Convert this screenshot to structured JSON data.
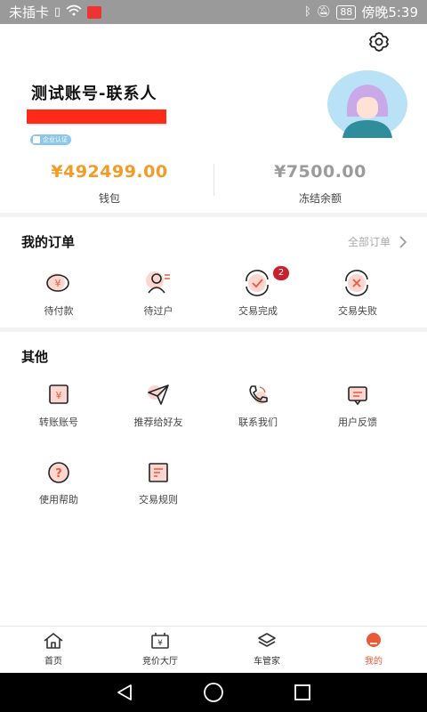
{
  "status_bar": {
    "carrier": "未插卡",
    "battery": "88",
    "time": "傍晚5:39"
  },
  "profile": {
    "name": "测试账号-联系人",
    "badge": "企业认证"
  },
  "balances": {
    "wallet_value": "¥492499.00",
    "wallet_label": "钱包",
    "frozen_value": "¥7500.00",
    "frozen_label": "冻结余额"
  },
  "orders": {
    "title": "我的订单",
    "all_link": "全部订单",
    "items": [
      {
        "label": "待付款",
        "icon": "yuan-wallet-icon"
      },
      {
        "label": "待过户",
        "icon": "user-transfer-icon"
      },
      {
        "label": "交易完成",
        "icon": "check-cycle-icon",
        "count": "2"
      },
      {
        "label": "交易失败",
        "icon": "close-cycle-icon"
      }
    ]
  },
  "other": {
    "title": "其他",
    "items": [
      {
        "label": "转账账号",
        "icon": "yuan-card-icon"
      },
      {
        "label": "推荐给好友",
        "icon": "send-icon"
      },
      {
        "label": "联系我们",
        "icon": "phone-icon"
      },
      {
        "label": "用户反馈",
        "icon": "feedback-icon"
      },
      {
        "label": "使用帮助",
        "icon": "help-icon"
      },
      {
        "label": "交易规则",
        "icon": "rules-doc-icon"
      }
    ]
  },
  "tabbar": {
    "items": [
      {
        "label": "首页",
        "icon": "home-icon"
      },
      {
        "label": "竞价大厅",
        "icon": "auction-icon"
      },
      {
        "label": "车管家",
        "icon": "layers-icon"
      },
      {
        "label": "我的",
        "icon": "profile-icon",
        "active": true
      }
    ]
  },
  "colors": {
    "accent": "#e85b3a",
    "wallet": "#f39b26",
    "frozen": "#9b9b9b",
    "redacted": "#ff2a1a"
  }
}
